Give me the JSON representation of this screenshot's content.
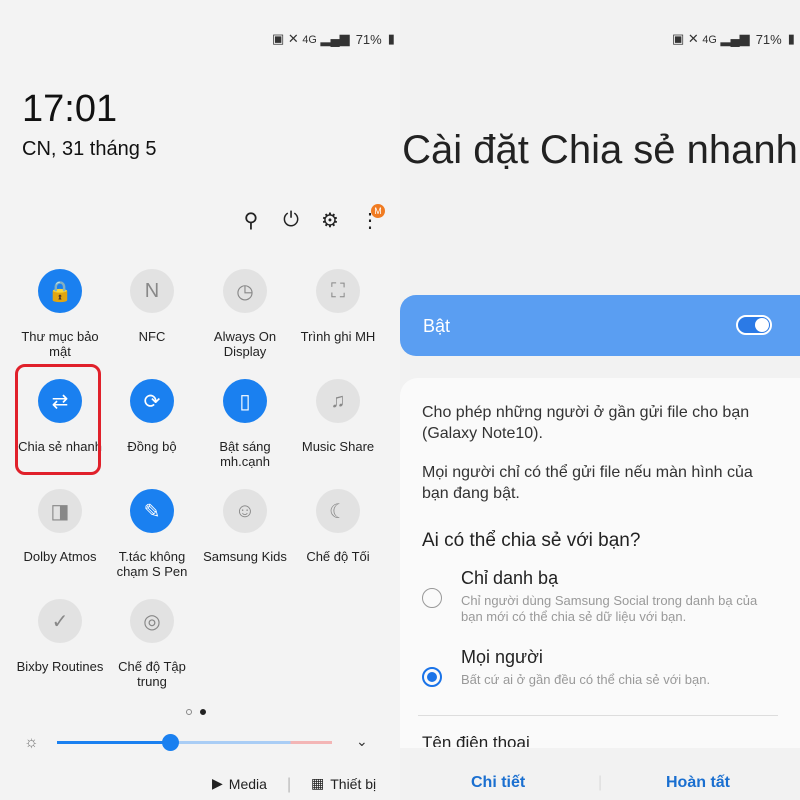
{
  "status": {
    "battery": "71%",
    "network": "4G"
  },
  "left": {
    "time": "17:01",
    "date": "CN, 31 tháng 5",
    "notification_badge": "M",
    "tiles": [
      {
        "label": "Thư mục bảo mật",
        "icon": "secure-folder-icon",
        "on": true
      },
      {
        "label": "NFC",
        "icon": "nfc-icon",
        "on": false
      },
      {
        "label": "Always On Display",
        "icon": "clock-icon",
        "on": false
      },
      {
        "label": "Trình ghi MH",
        "icon": "screen-recorder-icon",
        "on": false
      },
      {
        "label": "Chia sẻ nhanh",
        "icon": "quick-share-icon",
        "on": true
      },
      {
        "label": "Đồng bộ",
        "icon": "sync-icon",
        "on": true
      },
      {
        "label": "Bật sáng mh.cạnh",
        "icon": "edge-lighting-icon",
        "on": true
      },
      {
        "label": "Music Share",
        "icon": "music-share-icon",
        "on": false
      },
      {
        "label": "Dolby Atmos",
        "icon": "dolby-icon",
        "on": false
      },
      {
        "label": "T.tác không chạm S Pen",
        "icon": "spen-icon",
        "on": true
      },
      {
        "label": "Samsung Kids",
        "icon": "kids-icon",
        "on": false
      },
      {
        "label": "Chế độ Tối",
        "icon": "moon-icon",
        "on": false
      },
      {
        "label": "Bixby Routines",
        "icon": "routines-icon",
        "on": false
      },
      {
        "label": "Chế độ Tập trung",
        "icon": "focus-icon",
        "on": false
      }
    ],
    "brightness": 0.4,
    "media": "Media",
    "devices": "Thiết bị"
  },
  "right": {
    "title": "Cài đặt Chia sẻ nhanh",
    "toggle_label": "Bật",
    "toggle_on": true,
    "desc1": "Cho phép những người ở gần gửi file cho bạn (Galaxy Note10).",
    "desc2": "Mọi người chỉ có thể gửi file nếu màn hình của bạn đang bật.",
    "question": "Ai có thể chia sẻ với bạn?",
    "options": [
      {
        "title": "Chỉ danh bạ",
        "desc": "Chỉ người dùng Samsung Social trong danh bạ của bạn mới có thể chia sẻ dữ liệu với bạn.",
        "selected": false
      },
      {
        "title": "Mọi người",
        "desc": "Bất cứ ai ở gần đều có thể chia sẻ với bạn.",
        "selected": true
      }
    ],
    "phone_name_label": "Tên điện thoại",
    "details": "Chi tiết",
    "done": "Hoàn tất"
  },
  "colors": {
    "accent": "#1a80f0",
    "highlight": "#e0202a",
    "toggle_bar": "#5a9ef2"
  }
}
